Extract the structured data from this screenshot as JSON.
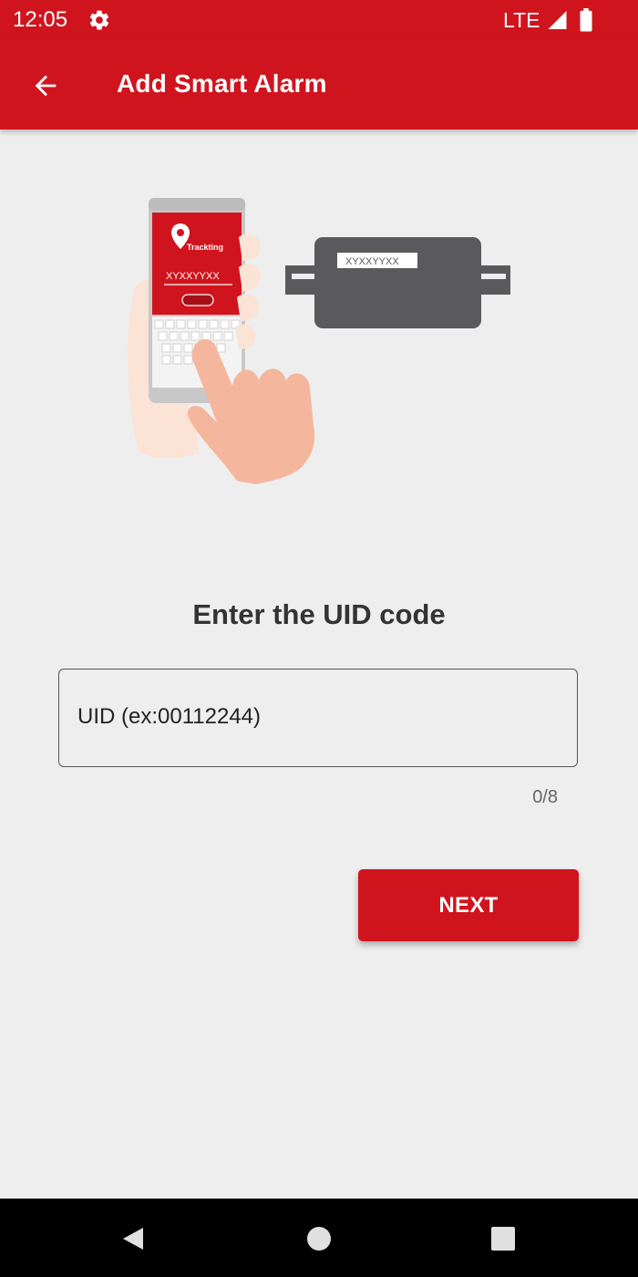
{
  "status_bar": {
    "time": "12:05",
    "network": "LTE",
    "icons": [
      "gear-icon",
      "signal-icon",
      "battery-icon"
    ]
  },
  "app_bar": {
    "title": "Add Smart Alarm",
    "back_icon": "arrow-left-icon"
  },
  "illustration": {
    "phone_app_name": "Trackting",
    "phone_code": "XYXXYYXX",
    "device_label": "XYXXYYXX"
  },
  "form": {
    "title": "Enter the UID code",
    "uid_value": "",
    "uid_placeholder": "UID (ex:00112244)",
    "counter": "0/8"
  },
  "actions": {
    "next_label": "NEXT"
  },
  "navigation": {
    "buttons": [
      "back-triangle-icon",
      "home-circle-icon",
      "recents-square-icon"
    ]
  },
  "colors": {
    "primary": "#d0141e",
    "background": "#eeeeee",
    "text": "#333333",
    "device": "#5a5a5c",
    "skin": "#f5b69e"
  }
}
